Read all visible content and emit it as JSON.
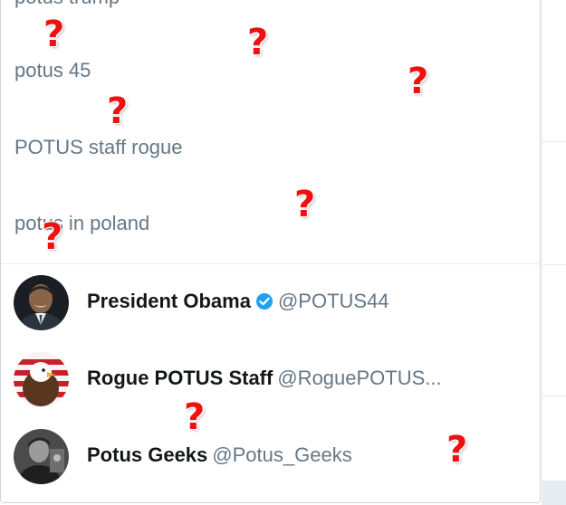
{
  "suggestions": {
    "partial": "potus trump",
    "items": [
      "potus 45",
      "POTUS staff rogue",
      "potus in poland"
    ]
  },
  "accounts": [
    {
      "name": "President Obama",
      "verified": true,
      "handle": "@POTUS44"
    },
    {
      "name": "Rogue POTUS Staff",
      "verified": false,
      "handle": "@RoguePOTUS..."
    },
    {
      "name": "Potus Geeks",
      "verified": false,
      "handle": "@Potus_Geeks"
    }
  ],
  "overlay": {
    "mark": "?",
    "color": "#ee1111"
  },
  "colors": {
    "verified_badge": "#1da1f2",
    "muted_text": "#657786",
    "name_text": "#14171a"
  }
}
